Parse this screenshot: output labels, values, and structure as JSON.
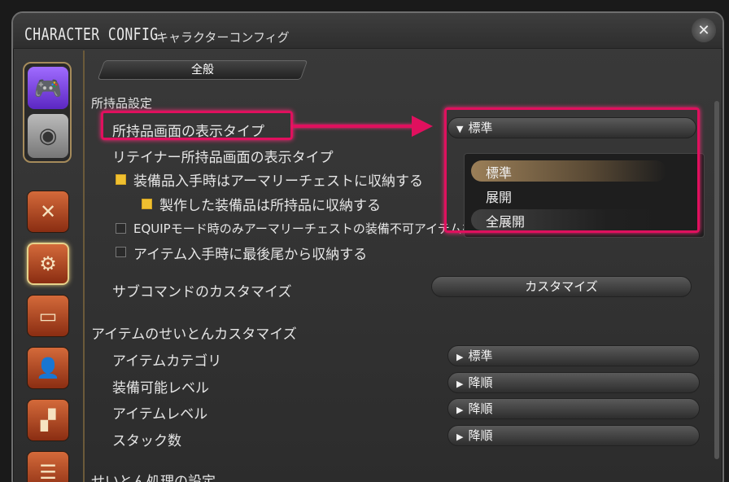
{
  "window": {
    "title": "CHARACTER CONFIG",
    "subtitle": "キャラクターコンフィグ"
  },
  "tab": {
    "label": "全般"
  },
  "sections": {
    "inventory": "所持品設定",
    "sort": "アイテムのせいとんカスタマイズ",
    "sort_process": "せいとん処理の設定"
  },
  "settings": {
    "inventory_display_type": {
      "label": "所持品画面の表示タイプ",
      "value": "標準"
    },
    "retainer_display_type": {
      "label": "リテイナー所持品画面の表示タイプ"
    },
    "store_armory_on_obtain": {
      "label": "装備品入手時はアーマリーチェストに収納する",
      "checked": true
    },
    "store_crafted_in_inventory": {
      "label": "製作した装備品は所持品に収納する",
      "checked": true
    },
    "equip_mode_armory": {
      "label": "EQUIPモード時のみアーマリーチェストの装備不可アイテムを暗くする",
      "checked": false
    },
    "store_last_on_obtain": {
      "label": "アイテム入手時に最後尾から収納する",
      "checked": false
    },
    "subcommand_customize": {
      "label": "サブコマンドのカスタマイズ",
      "button": "カスタマイズ"
    },
    "item_category": {
      "label": "アイテムカテゴリ",
      "value": "標準"
    },
    "equip_level": {
      "label": "装備可能レベル",
      "value": "降順"
    },
    "item_level": {
      "label": "アイテムレベル",
      "value": "降順"
    },
    "stack_count": {
      "label": "スタック数",
      "value": "降順"
    }
  },
  "dropdown": {
    "options": [
      "標準",
      "展開",
      "全展開"
    ],
    "selected": "標準"
  },
  "colors": {
    "highlight": "#e0105e",
    "checkbox_on": "#f0c030"
  }
}
